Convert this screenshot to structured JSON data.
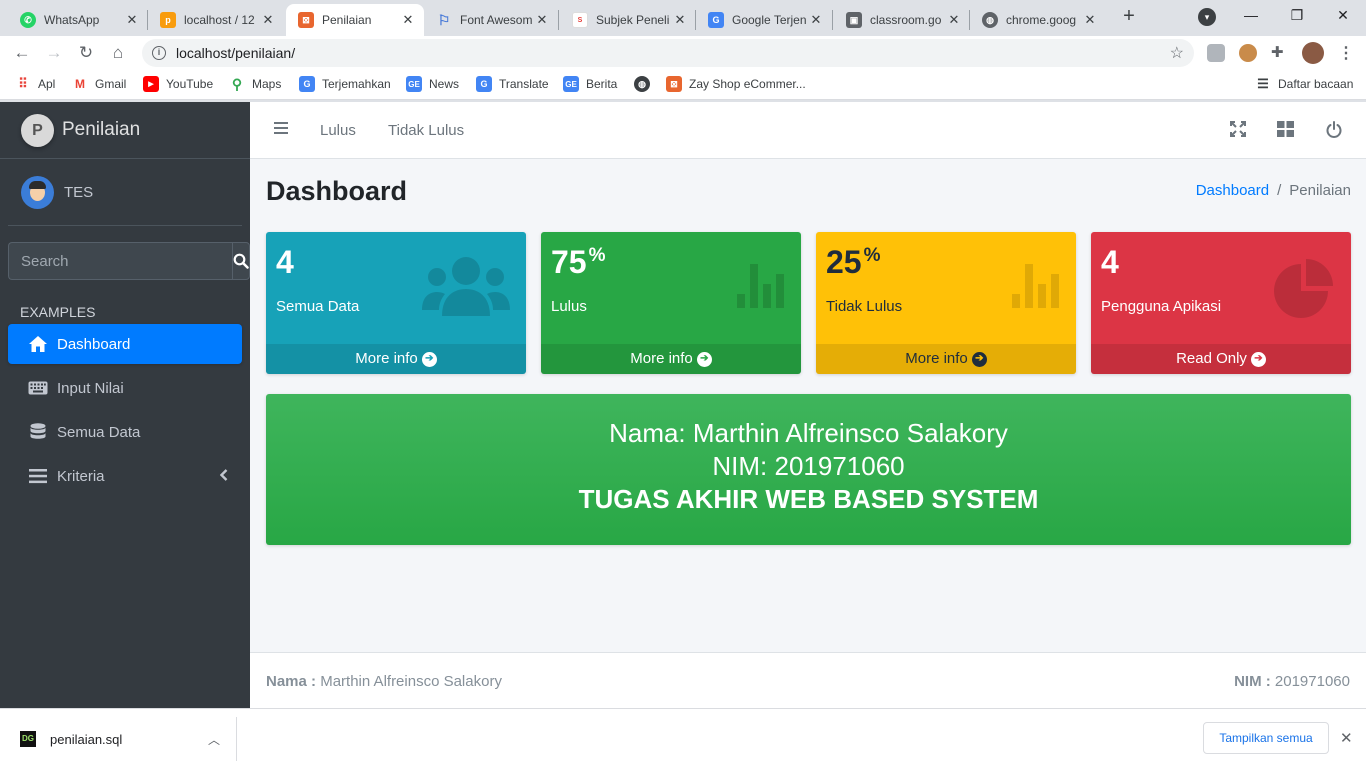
{
  "browser": {
    "tabs": [
      {
        "title": "WhatsApp",
        "icon": "whatsapp-icon",
        "color": "#25d366"
      },
      {
        "title": "localhost / 12",
        "icon": "phpmyadmin-icon",
        "color": "#f89c0e"
      },
      {
        "title": "Penilaian",
        "icon": "penilaian-favicon",
        "color": "#e8662f"
      },
      {
        "title": "Font Awesom",
        "icon": "flag-icon",
        "color": "#4a7bd8"
      },
      {
        "title": "Subjek Peneli",
        "icon": "sevima-icon",
        "color": "#e53935"
      },
      {
        "title": "Google Terjen",
        "icon": "google-translate-icon",
        "color": "#4285f4"
      },
      {
        "title": "classroom.go",
        "icon": "classroom-icon",
        "color": "#5f6368"
      },
      {
        "title": "chrome.goog",
        "icon": "globe-icon",
        "color": "#5f6368"
      }
    ],
    "url": "localhost/penilaian/",
    "bookmarks": [
      {
        "label": "Apl",
        "icon": "apps-grid-icon"
      },
      {
        "label": "Gmail",
        "icon": "gmail-icon"
      },
      {
        "label": "YouTube",
        "icon": "youtube-icon"
      },
      {
        "label": "Maps",
        "icon": "maps-icon"
      },
      {
        "label": "Terjemahkan",
        "icon": "translate-icon"
      },
      {
        "label": "News",
        "icon": "news-icon"
      },
      {
        "label": "Translate",
        "icon": "translate-icon"
      },
      {
        "label": "Berita",
        "icon": "news-icon"
      },
      {
        "label": "",
        "icon": "globe-icon"
      },
      {
        "label": "Zay Shop eCommer...",
        "icon": "xampp-icon"
      }
    ],
    "reading_list": "Daftar bacaan"
  },
  "sidebar": {
    "brand": "Penilaian",
    "brand_logo": "P",
    "user": "TES",
    "search_placeholder": "Search",
    "section": "EXAMPLES",
    "items": [
      {
        "label": "Dashboard",
        "icon": "home-icon",
        "active": true
      },
      {
        "label": "Input Nilai",
        "icon": "keyboard-icon"
      },
      {
        "label": "Semua Data",
        "icon": "database-icon"
      },
      {
        "label": "Kriteria",
        "icon": "list-icon"
      }
    ]
  },
  "topnav": {
    "links": [
      "Lulus",
      "Tidak Lulus"
    ]
  },
  "header": {
    "title": "Dashboard",
    "breadcrumb": [
      "Dashboard",
      "Penilaian"
    ]
  },
  "boxes": [
    {
      "value": "4",
      "suffix": "",
      "label": "Semua Data",
      "footer": "More info",
      "icon": "users-icon",
      "color": "#17a2b8"
    },
    {
      "value": "75",
      "suffix": "%",
      "label": "Lulus",
      "footer": "More info",
      "icon": "bar-chart-icon",
      "color": "#28a745"
    },
    {
      "value": "25",
      "suffix": "%",
      "label": "Tidak Lulus",
      "footer": "More info",
      "icon": "bar-chart-icon",
      "color": "#ffc107"
    },
    {
      "value": "4",
      "suffix": "",
      "label": "Pengguna Apikasi",
      "footer": "Read Only",
      "icon": "pie-chart-icon",
      "color": "#dc3545"
    }
  ],
  "banner": {
    "line1": "Nama: Marthin Alfreinsco Salakory",
    "line2": "NIM: 201971060",
    "line3": "TUGAS AKHIR WEB BASED SYSTEM"
  },
  "footer": {
    "name_label": "Nama :",
    "name": "Marthin Alfreinsco Salakory",
    "nim_label": "NIM :",
    "nim": "201971060"
  },
  "downloads": {
    "file": "penilaian.sql",
    "show_all": "Tampilkan semua"
  }
}
